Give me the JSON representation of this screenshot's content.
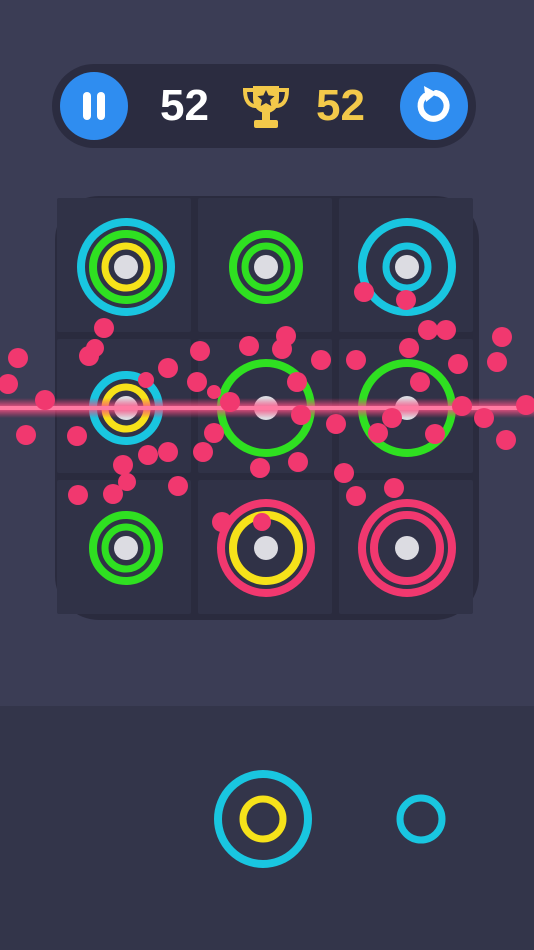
{
  "hud": {
    "current_score": "52",
    "best_score": "52",
    "pause_icon": "pause-icon",
    "trophy_icon": "trophy-icon",
    "restart_icon": "restart-icon"
  },
  "colors": {
    "background": "#3b3d55",
    "board": "#2a2b3e",
    "cell": "#303247",
    "button": "#2f8df0",
    "best_score": "#f3c94a",
    "cyan": "#19c6e0",
    "green": "#2fe021",
    "yellow": "#f6e21a",
    "pink": "#f1386f"
  },
  "board": {
    "rows": 3,
    "cols": 3,
    "cells": [
      {
        "row": 0,
        "col": 0,
        "rings": [
          "large-cyan",
          "medium-green",
          "small-yellow"
        ]
      },
      {
        "row": 0,
        "col": 1,
        "rings": [
          "medium-green",
          "small-green"
        ]
      },
      {
        "row": 0,
        "col": 2,
        "rings": [
          "large-cyan",
          "small-cyan"
        ]
      },
      {
        "row": 1,
        "col": 0,
        "rings": [
          "medium-cyan",
          "small-yellow"
        ]
      },
      {
        "row": 1,
        "col": 1,
        "rings": [
          "large-green"
        ]
      },
      {
        "row": 1,
        "col": 2,
        "rings": [
          "large-green"
        ]
      },
      {
        "row": 2,
        "col": 0,
        "rings": [
          "medium-green",
          "small-green"
        ]
      },
      {
        "row": 2,
        "col": 1,
        "rings": [
          "large-pink",
          "medium-yellow"
        ]
      },
      {
        "row": 2,
        "col": 2,
        "rings": [
          "large-pink",
          "medium-pink"
        ]
      }
    ]
  },
  "tray": {
    "pieces": [
      {
        "rings": [
          "large-cyan",
          "small-yellow"
        ]
      },
      {
        "rings": [
          "small-cyan"
        ]
      }
    ]
  },
  "effects": {
    "line_clear": "row-2",
    "particle_color": "pink"
  }
}
